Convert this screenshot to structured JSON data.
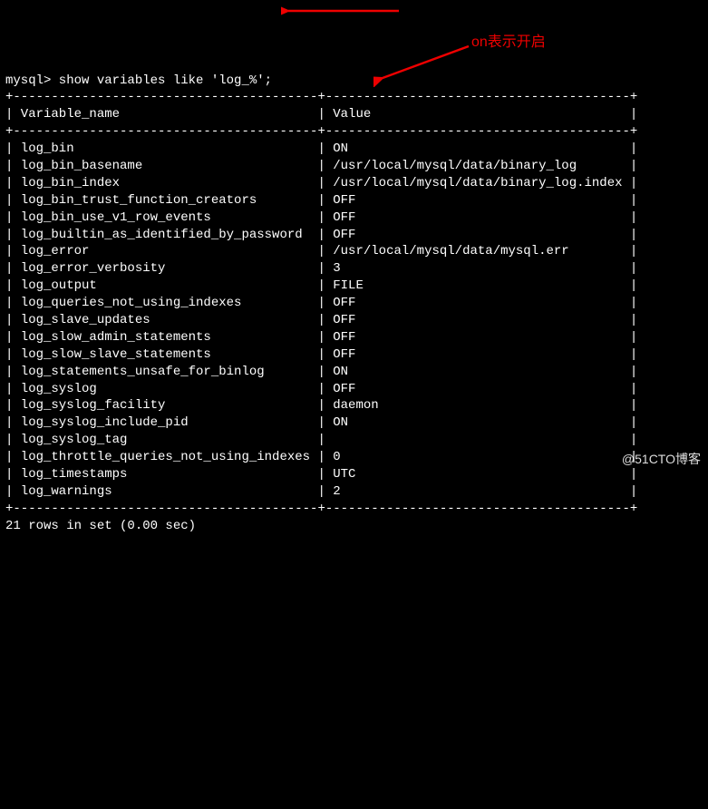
{
  "prompt": "mysql> show variables like 'log_%';",
  "headers": {
    "col1": "Variable_name",
    "col2": "Value"
  },
  "rows": [
    {
      "name": "log_bin",
      "value": "ON"
    },
    {
      "name": "log_bin_basename",
      "value": "/usr/local/mysql/data/binary_log"
    },
    {
      "name": "log_bin_index",
      "value": "/usr/local/mysql/data/binary_log.index"
    },
    {
      "name": "log_bin_trust_function_creators",
      "value": "OFF"
    },
    {
      "name": "log_bin_use_v1_row_events",
      "value": "OFF"
    },
    {
      "name": "log_builtin_as_identified_by_password",
      "value": "OFF"
    },
    {
      "name": "log_error",
      "value": "/usr/local/mysql/data/mysql.err"
    },
    {
      "name": "log_error_verbosity",
      "value": "3"
    },
    {
      "name": "log_output",
      "value": "FILE"
    },
    {
      "name": "log_queries_not_using_indexes",
      "value": "OFF"
    },
    {
      "name": "log_slave_updates",
      "value": "OFF"
    },
    {
      "name": "log_slow_admin_statements",
      "value": "OFF"
    },
    {
      "name": "log_slow_slave_statements",
      "value": "OFF"
    },
    {
      "name": "log_statements_unsafe_for_binlog",
      "value": "ON"
    },
    {
      "name": "log_syslog",
      "value": "OFF"
    },
    {
      "name": "log_syslog_facility",
      "value": "daemon"
    },
    {
      "name": "log_syslog_include_pid",
      "value": "ON"
    },
    {
      "name": "log_syslog_tag",
      "value": ""
    },
    {
      "name": "log_throttle_queries_not_using_indexes",
      "value": "0"
    },
    {
      "name": "log_timestamps",
      "value": "UTC"
    },
    {
      "name": "log_warnings",
      "value": "2"
    }
  ],
  "footer": "21 rows in set (0.00 sec)",
  "annotation": "on表示开启",
  "watermark": "@51CTO博客",
  "widths": {
    "col1": 38,
    "col2": 38
  }
}
